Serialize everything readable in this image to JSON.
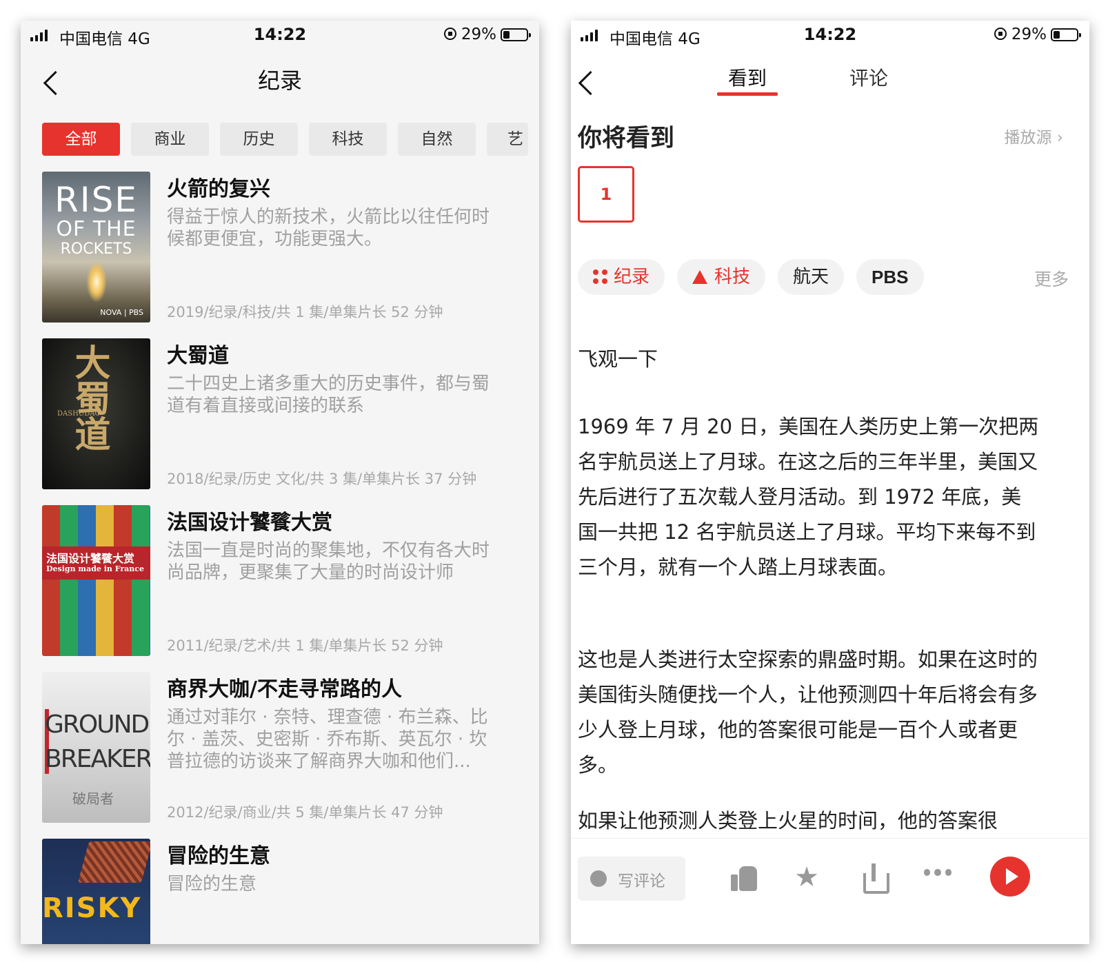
{
  "left": {
    "status": {
      "carrier": "中国电信  4G",
      "time": "14:22",
      "battery": "29%"
    },
    "nav_title": "纪录",
    "categories": [
      "全部",
      "商业",
      "历史",
      "科技",
      "自然",
      "艺"
    ],
    "items": [
      {
        "title": "火箭的复兴",
        "desc": "得益于惊人的新技术，火箭比以往任何时候都更便宜，功能更强大。",
        "meta": "2019/纪录/科技/共 1 集/单集片长 52 分钟",
        "poster": {
          "line1": "RISE",
          "line2": "OF THE",
          "line3": "ROCKETS",
          "footer": "NOVA | PBS"
        }
      },
      {
        "title": "大蜀道",
        "desc": "二十四史上诸多重大的历史事件，都与蜀道有着直接或间接的联系",
        "meta": "2018/纪录/历史 文化/共 3 集/单集片长 37 分钟",
        "poster": {
          "big": "大蜀道",
          "small": "DASHUDAO"
        }
      },
      {
        "title": "法国设计饕餮大赏",
        "desc": "法国一直是时尚的聚集地，不仅有各大时尚品牌，更聚集了大量的时尚设计师",
        "meta": "2011/纪录/艺术/共 1 集/单集片长 52 分钟",
        "poster": {
          "line1": "法国设计饕餮大赏",
          "line2": "Design made in France"
        }
      },
      {
        "title": "商界大咖/不走寻常路的人",
        "desc": "通过对菲尔 · 奈特、理查德 · 布兰森、比尔 · 盖茨、史密斯 · 乔布斯、英瓦尔 · 坎普拉德的访谈来了解商界大咖和他们...",
        "meta": "2012/纪录/商业/共 5 集/单集片长 47 分钟",
        "poster": {
          "line1": "GROUND",
          "line2": "BREAKERS",
          "line3": "破局者"
        }
      },
      {
        "title": "冒险的生意",
        "desc": "冒险的生意",
        "meta": "",
        "poster": {
          "line1": "RISKY"
        }
      }
    ]
  },
  "right": {
    "status": {
      "carrier": "中国电信  4G",
      "time": "14:22",
      "battery": "29%"
    },
    "tabs": [
      "看到",
      "评论"
    ],
    "heading": "你将看到",
    "source_link": "播放源 ›",
    "episode": "1",
    "tags": [
      "纪录",
      "科技",
      "航天",
      "PBS"
    ],
    "more": "更多",
    "subheading": "飞观一下",
    "paragraphs": [
      "1969 年 7 月 20 日，美国在人类历史上第一次把两名宇航员送上了月球。在这之后的三年半里，美国又先后进行了五次载人登月活动。到 1972 年底，美国一共把 12 名宇航员送上了月球。平均下来每不到三个月，就有一个人踏上月球表面。",
      "这也是人类进行太空探索的鼎盛时期。如果在这时的美国街头随便找一个人，让他预测四十年后将会有多少人登上月球，他的答案很可能是一百个人或者更多。",
      "如果让他预测人类登上火星的时间，他的答案很"
    ],
    "comment_placeholder": "写评论",
    "icons": [
      "comment-icon",
      "thumbs-up-icon",
      "star-icon",
      "share-icon",
      "more-icon",
      "play-icon"
    ],
    "accent_color": "#e7332d"
  }
}
